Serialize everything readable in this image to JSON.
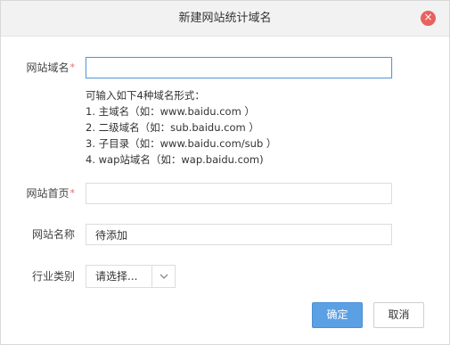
{
  "dialog": {
    "title": "新建网站统计域名",
    "close_icon": "close-icon"
  },
  "form": {
    "domain": {
      "label": "网站域名",
      "required_mark": "*",
      "value": ""
    },
    "hint": {
      "intro": "可输入如下4种域名形式：",
      "items": [
        "1. 主域名（如：www.baidu.com ）",
        "2. 二级域名（如：sub.baidu.com ）",
        "3. 子目录（如：www.baidu.com/sub ）",
        "4. wap站域名（如：wap.baidu.com)"
      ]
    },
    "homepage": {
      "label": "网站首页",
      "required_mark": "*",
      "value": ""
    },
    "site_name": {
      "label": "网站名称",
      "value": "待添加"
    },
    "industry": {
      "label": "行业类别",
      "selected": "请选择...",
      "arrow_icon": "chevron-down-icon"
    }
  },
  "buttons": {
    "ok": "确定",
    "cancel": "取消"
  },
  "colors": {
    "title_bar": "#f2f2f2",
    "close": "#e8615e",
    "primary": "#5ca0e4",
    "focus_border": "#5a9ad6",
    "required": "#e56a6a"
  }
}
